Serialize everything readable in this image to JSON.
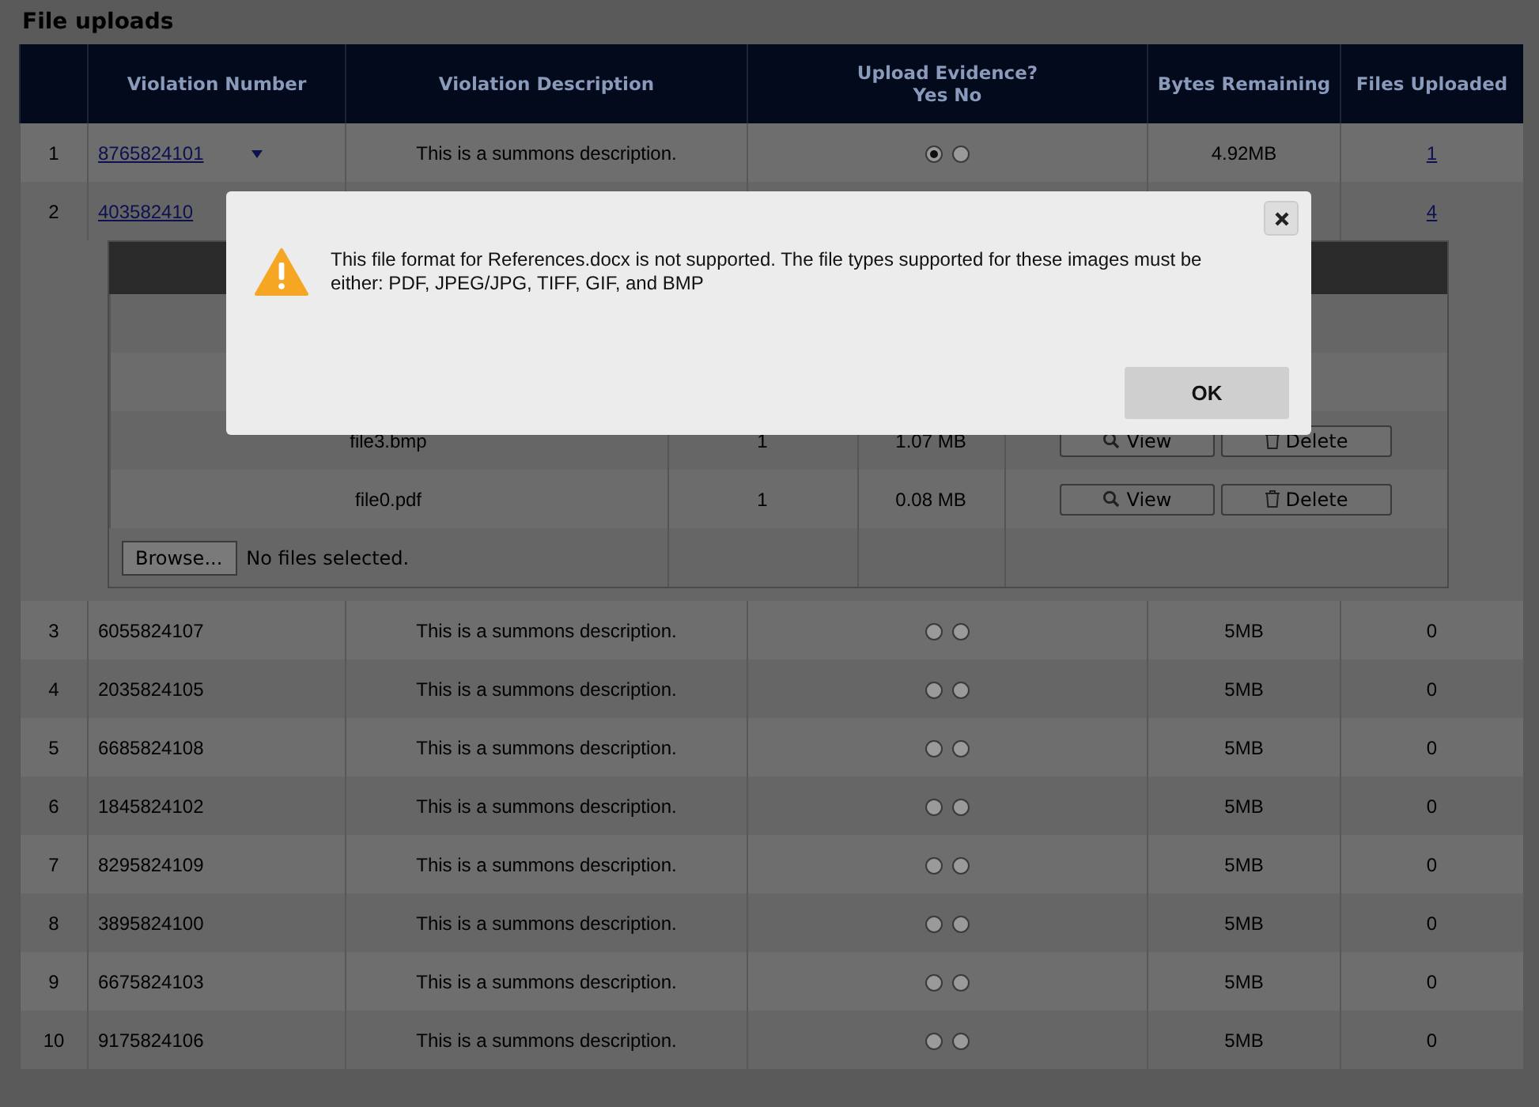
{
  "title": "File uploads",
  "table": {
    "columns": [
      {
        "label": "Violation Number"
      },
      {
        "label": "Violation Description"
      },
      {
        "label": "Upload Evidence?",
        "sublabel": "Yes No"
      },
      {
        "label": "Bytes Remaining"
      },
      {
        "label": "Files Uploaded"
      }
    ],
    "rows": [
      {
        "index": "1",
        "number": "8765824101",
        "linked": true,
        "caret": true,
        "description": "This is a summons description.",
        "radios": [
          {
            "selected": true
          },
          {
            "selected": false
          }
        ],
        "bytes": "4.92MB",
        "files": "1",
        "files_linked": true
      },
      {
        "index": "2",
        "number": "403582410",
        "linked": true,
        "caret": false,
        "files": "4",
        "files_linked": true,
        "details": {
          "files": [
            {
              "kind": "covered"
            },
            {
              "kind": "covered"
            },
            {
              "kind": "file",
              "name": "file3.bmp",
              "count": "1",
              "size": "1.07 MB",
              "view": "View",
              "delete": "Delete"
            },
            {
              "kind": "file",
              "name": "file0.pdf",
              "count": "1",
              "size": "0.08 MB",
              "view": "View",
              "delete": "Delete"
            }
          ],
          "browse": "Browse...",
          "status": "No files selected."
        }
      },
      {
        "index": "3",
        "number": "6055824107",
        "linked": false,
        "caret": false,
        "description": "This is a summons description.",
        "radios": [
          {
            "selected": false
          },
          {
            "selected": false
          }
        ],
        "bytes": "5MB",
        "files": "0",
        "files_linked": false
      },
      {
        "index": "4",
        "number": "2035824105",
        "linked": false,
        "caret": false,
        "description": "This is a summons description.",
        "radios": [
          {
            "selected": false
          },
          {
            "selected": false
          }
        ],
        "bytes": "5MB",
        "files": "0",
        "files_linked": false
      },
      {
        "index": "5",
        "number": "6685824108",
        "linked": false,
        "caret": false,
        "description": "This is a summons description.",
        "radios": [
          {
            "selected": false
          },
          {
            "selected": false
          }
        ],
        "bytes": "5MB",
        "files": "0",
        "files_linked": false
      },
      {
        "index": "6",
        "number": "1845824102",
        "linked": false,
        "caret": false,
        "description": "This is a summons description.",
        "radios": [
          {
            "selected": false
          },
          {
            "selected": false
          }
        ],
        "bytes": "5MB",
        "files": "0",
        "files_linked": false
      },
      {
        "index": "7",
        "number": "8295824109",
        "linked": false,
        "caret": false,
        "description": "This is a summons description.",
        "radios": [
          {
            "selected": false
          },
          {
            "selected": false
          }
        ],
        "bytes": "5MB",
        "files": "0",
        "files_linked": false
      },
      {
        "index": "8",
        "number": "3895824100",
        "linked": false,
        "caret": false,
        "description": "This is a summons description.",
        "radios": [
          {
            "selected": false
          },
          {
            "selected": false
          }
        ],
        "bytes": "5MB",
        "files": "0",
        "files_linked": false
      },
      {
        "index": "9",
        "number": "6675824103",
        "linked": false,
        "caret": false,
        "description": "This is a summons description.",
        "radios": [
          {
            "selected": false
          },
          {
            "selected": false
          }
        ],
        "bytes": "5MB",
        "files": "0",
        "files_linked": false
      },
      {
        "index": "10",
        "number": "9175824106",
        "linked": false,
        "caret": false,
        "description": "This is a summons description.",
        "radios": [
          {
            "selected": false
          },
          {
            "selected": false
          }
        ],
        "bytes": "5MB",
        "files": "0",
        "files_linked": false
      }
    ]
  },
  "dialog": {
    "message": "This file format for References.docx is not supported. The file types supported for these images must be either: PDF, JPEG/JPG, TIFF, GIF, and BMP",
    "ok": "OK"
  }
}
